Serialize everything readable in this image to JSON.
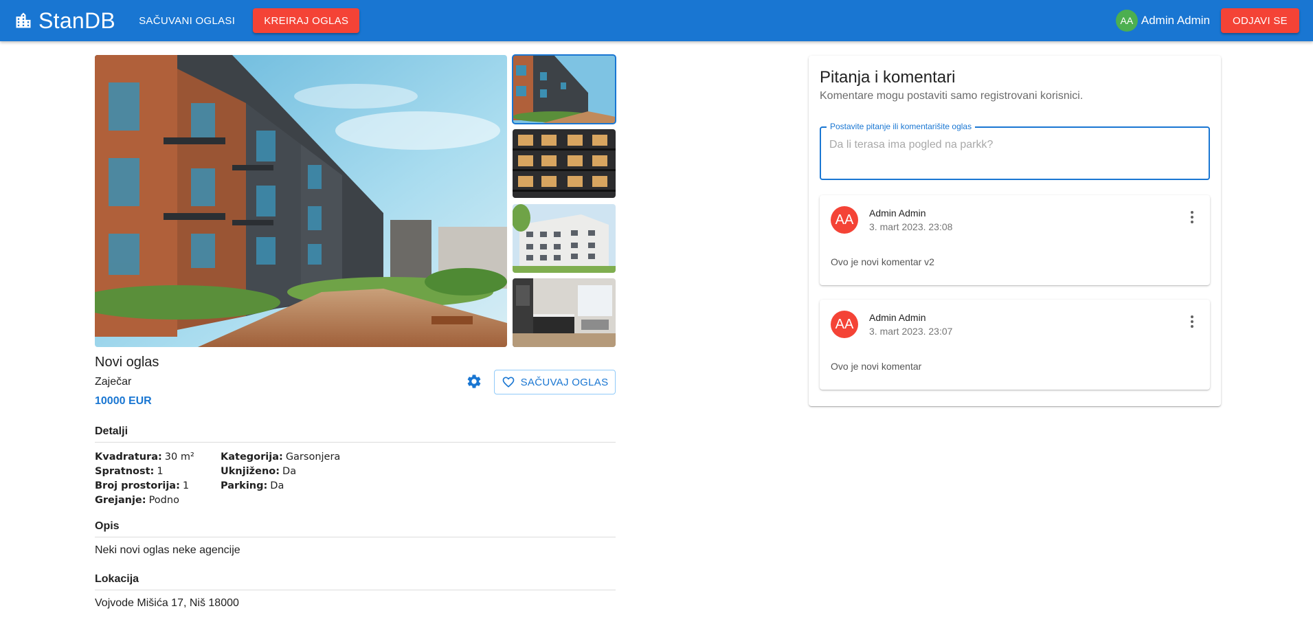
{
  "header": {
    "brand": "StanDB",
    "brand_icon": "building-icon",
    "saved_link": "SAČUVANI OGLASI",
    "create_button": "KREIRAJ OGLAS",
    "user_initials": "AA",
    "user_name": "Admin Admin",
    "logout_button": "ODJAVI SE"
  },
  "gallery": {
    "main_image": "apartment-building-courtyard",
    "thumbnails": [
      "apartment-building-courtyard",
      "dark-facade-balconies",
      "white-residential-building",
      "kitchen-living-interior"
    ],
    "selected_index": 0
  },
  "listing": {
    "title": "Novi oglas",
    "city": "Zaječar",
    "price": "10000 EUR",
    "settings_icon": "gear-icon",
    "save_button": "SAČUVAJ OGLAS",
    "save_icon": "heart-outline-icon"
  },
  "details": {
    "heading": "Detalji",
    "col1": [
      {
        "label": "Kvadratura:",
        "value": "30 m²"
      },
      {
        "label": "Spratnost:",
        "value": "1"
      },
      {
        "label": "Broj prostorija:",
        "value": "1"
      },
      {
        "label": "Grejanje:",
        "value": "Podno"
      }
    ],
    "col2": [
      {
        "label": "Kategorija:",
        "value": "Garsonjera"
      },
      {
        "label": "Uknjiženo:",
        "value": "Da"
      },
      {
        "label": "Parking:",
        "value": "Da"
      }
    ]
  },
  "description": {
    "heading": "Opis",
    "text": "Neki novi oglas neke agencije"
  },
  "location": {
    "heading": "Lokacija",
    "text": "Vojvode Mišića 17, Niš 18000"
  },
  "comments": {
    "title": "Pitanja i komentari",
    "subtitle": "Komentare mogu postaviti samo registrovani korisnici.",
    "input_label": "Postavite pitanje ili komentarišite oglas",
    "input_value": "",
    "input_placeholder": "Da li terasa ima pogled na parkk?",
    "items": [
      {
        "initials": "AA",
        "author": "Admin Admin",
        "date": "3. mart 2023. 23:08",
        "text": "Ovo je novi komentar v2"
      },
      {
        "initials": "AA",
        "author": "Admin Admin",
        "date": "3. mart 2023. 23:07",
        "text": "Ovo je novi komentar"
      }
    ]
  },
  "colors": {
    "primary": "#1976d2",
    "accent_red": "#f44336",
    "avatar_green": "#4caf50"
  }
}
